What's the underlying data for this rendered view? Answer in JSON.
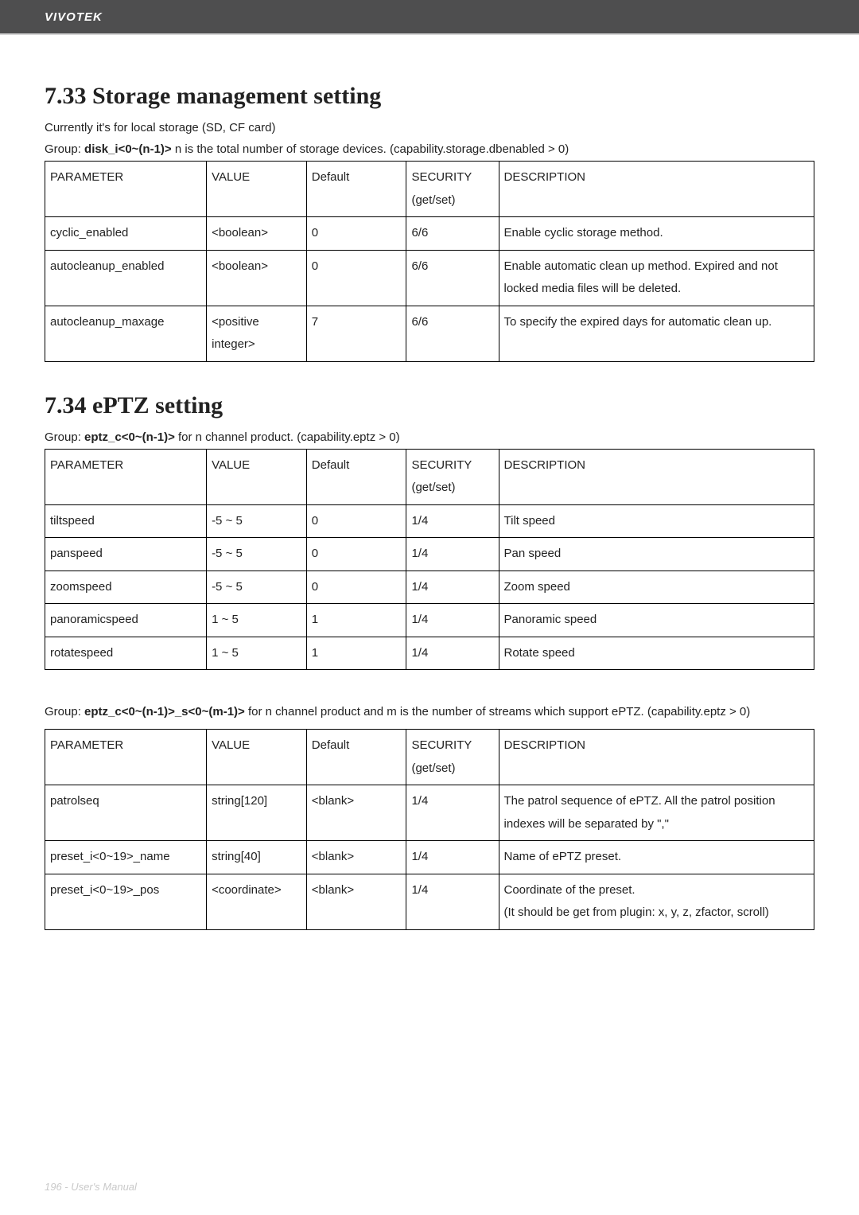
{
  "header": {
    "brand": "VIVOTEK"
  },
  "footer": {
    "text": "196 - User's Manual"
  },
  "sections": [
    {
      "title": "7.33 Storage management setting",
      "intro": "Currently it's for local storage (SD, CF card)",
      "group_prefix": "Group: ",
      "group_bold": "disk_i<0~(n-1)>",
      "group_suffix": " n is the total number of storage devices. (capability.storage.dbenabled > 0)",
      "headers": [
        "PARAMETER",
        "VALUE",
        "Default",
        "SECURITY (get/set)",
        "DESCRIPTION"
      ],
      "rows": [
        {
          "param": "cyclic_enabled",
          "value": "<boolean>",
          "default": "0",
          "security": "6/6",
          "desc": "Enable cyclic storage method."
        },
        {
          "param": "autocleanup_enabled",
          "value": "<boolean>",
          "default": "0",
          "security": "6/6",
          "desc": "Enable automatic clean up method. Expired and not locked media files will be deleted."
        },
        {
          "param": "autocleanup_maxage",
          "value": "<positive integer>",
          "default": "7",
          "security": "6/6",
          "desc": "To specify the expired days for automatic clean up."
        }
      ]
    },
    {
      "title": "7.34 ePTZ setting",
      "intro": "",
      "group_prefix": "Group: ",
      "group_bold": "eptz_c<0~(n-1)>",
      "group_suffix": " for n channel product. (capability.eptz > 0)",
      "headers": [
        "PARAMETER",
        "VALUE",
        "Default",
        "SECURITY (get/set)",
        "DESCRIPTION"
      ],
      "rows": [
        {
          "param": "tiltspeed",
          "value": "-5 ~ 5",
          "default": "0",
          "security": "1/4",
          "desc": "Tilt speed"
        },
        {
          "param": "panspeed",
          "value": "-5 ~ 5",
          "default": "0",
          "security": "1/4",
          "desc": "Pan speed"
        },
        {
          "param": "zoomspeed",
          "value": "-5 ~ 5",
          "default": "0",
          "security": "1/4",
          "desc": "Zoom speed"
        },
        {
          "param": "panoramicspeed",
          "value": "1 ~ 5",
          "default": "1",
          "security": "1/4",
          "desc": "Panoramic speed"
        },
        {
          "param": "rotatespeed",
          "value": "1 ~ 5",
          "default": "1",
          "security": "1/4",
          "desc": "Rotate speed"
        }
      ]
    },
    {
      "title": "",
      "intro": "",
      "group_prefix": "Group: ",
      "group_bold": "eptz_c<0~(n-1)>_s<0~(m-1)>",
      "group_suffix": " for n channel product and m is the number of streams which support ePTZ. (capability.eptz > 0)",
      "headers": [
        "PARAMETER",
        "VALUE",
        "Default",
        "SECURITY (get/set)",
        "DESCRIPTION"
      ],
      "rows": [
        {
          "param": "patrolseq",
          "value": "string[120]",
          "default": "<blank>",
          "security": "1/4",
          "desc": "The patrol sequence of ePTZ. All the patrol position indexes will be separated by \",\""
        },
        {
          "param": "preset_i<0~19>_name",
          "value": "string[40]",
          "default": "<blank>",
          "security": "1/4",
          "desc": "Name of ePTZ preset."
        },
        {
          "param": "preset_i<0~19>_pos",
          "value": "<coordinate>",
          "default": "<blank>",
          "security": "1/4",
          "desc": "Coordinate of the preset.\n(It should be get from plugin: x, y, z, zfactor, scroll)"
        }
      ]
    }
  ]
}
